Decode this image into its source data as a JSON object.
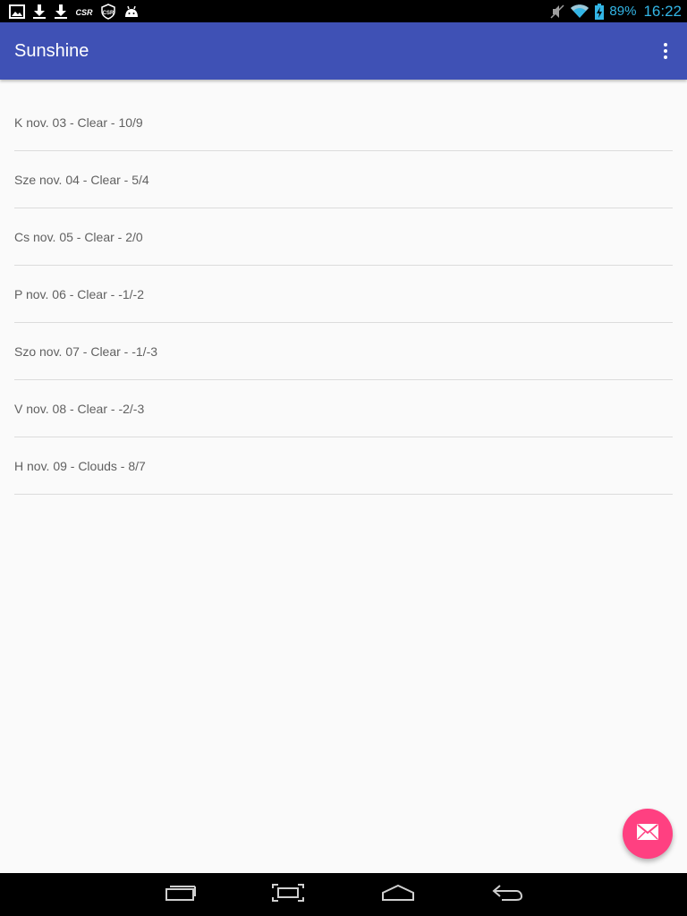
{
  "status_bar": {
    "battery_percent": "89%",
    "time": "16:22",
    "left_icons": [
      "gallery-icon",
      "download-icon",
      "download-icon",
      "csr-icon",
      "csr-shield-icon",
      "android-icon"
    ],
    "right_icons": [
      "muted-icon",
      "wifi-icon",
      "battery-charging-icon"
    ],
    "accent_color": "#33b5e5"
  },
  "app_bar": {
    "title": "Sunshine",
    "background_color": "#3f51b5",
    "menu_icon": "overflow-menu-icon"
  },
  "forecast": [
    {
      "label": "K nov. 03 - Clear - 10/9"
    },
    {
      "label": "Sze nov. 04 - Clear - 5/4"
    },
    {
      "label": "Cs nov. 05 - Clear - 2/0"
    },
    {
      "label": "P nov. 06 - Clear - -1/-2"
    },
    {
      "label": "Szo nov. 07 - Clear - -1/-3"
    },
    {
      "label": "V nov. 08 - Clear - -2/-3"
    },
    {
      "label": "H nov. 09 - Clouds - 8/7"
    }
  ],
  "fab": {
    "icon": "email-icon",
    "color": "#ff4081"
  },
  "nav_bar": {
    "buttons": [
      "recent-apps-icon",
      "screenshot-icon",
      "home-icon",
      "back-icon"
    ]
  }
}
